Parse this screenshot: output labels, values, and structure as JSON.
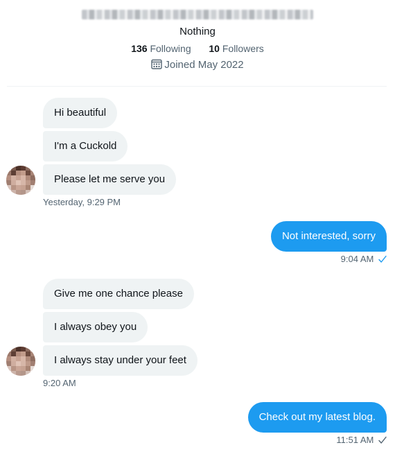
{
  "profile": {
    "bio": "Nothing",
    "following_count": "136",
    "following_label": "Following",
    "followers_count": "10",
    "followers_label": "Followers",
    "joined": "Joined May 2022"
  },
  "messages": [
    {
      "direction": "in",
      "text": "Hi beautiful"
    },
    {
      "direction": "in",
      "text": "I'm a Cuckold"
    },
    {
      "direction": "in",
      "text": "Please let me serve you"
    },
    {
      "direction": "in",
      "timestamp": "Yesterday, 9:29 PM"
    },
    {
      "direction": "out",
      "text": "Not interested, sorry",
      "timestamp": "9:04 AM",
      "status_icon": "check-icon"
    },
    {
      "direction": "in",
      "text": "Give me one chance please"
    },
    {
      "direction": "in",
      "text": "I always obey you"
    },
    {
      "direction": "in",
      "text": "I always stay under your feet"
    },
    {
      "direction": "in",
      "timestamp": "9:20 AM"
    },
    {
      "direction": "out",
      "text": "Check out my latest blog.",
      "timestamp": "11:51 AM",
      "status_icon": "check-icon"
    }
  ],
  "colors": {
    "accent": "#1d9bf0",
    "incoming_bubble": "#eff3f4",
    "secondary_text": "#536471",
    "primary_text": "#0f1419",
    "read_check_blue": "#1d9bf0",
    "sent_check_gray": "#536471"
  },
  "icons": {
    "joined": "calendar-icon",
    "delivered": "check-icon"
  }
}
